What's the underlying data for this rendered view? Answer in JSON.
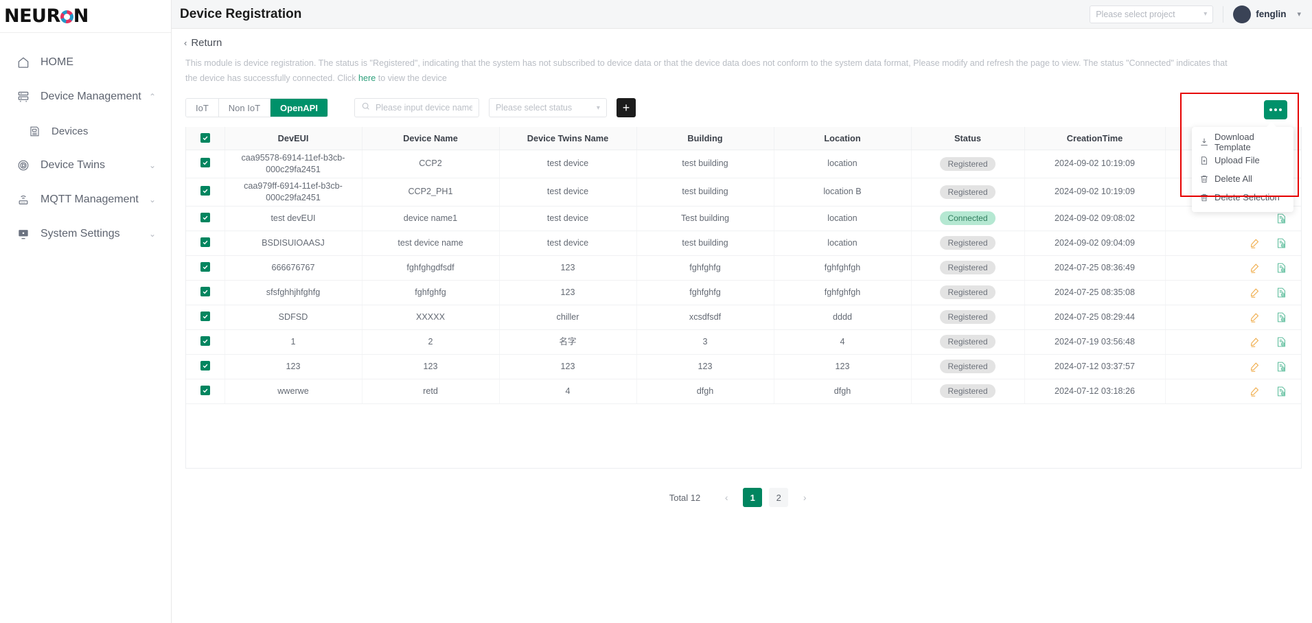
{
  "brand": {
    "name_left": "NEUR",
    "name_right": "N",
    "dot_icon": "neuron-dot-icon"
  },
  "sidebar": {
    "items": [
      {
        "label": "HOME",
        "icon": "home-icon",
        "chevron": "",
        "sub": false
      },
      {
        "label": "Device Management",
        "icon": "server-icon",
        "chevron": "⌃",
        "sub": false
      },
      {
        "label": "Devices",
        "icon": "device-icon",
        "chevron": "",
        "sub": true
      },
      {
        "label": "Device Twins",
        "icon": "twins-icon",
        "chevron": "⌄",
        "sub": false
      },
      {
        "label": "MQTT Management",
        "icon": "mqtt-icon",
        "chevron": "⌄",
        "sub": false
      },
      {
        "label": "System Settings",
        "icon": "monitor-icon",
        "chevron": "⌄",
        "sub": false
      }
    ]
  },
  "header": {
    "title": "Device Registration",
    "project_placeholder": "Please select project",
    "user_name": "fenglin"
  },
  "page": {
    "return_label": "Return",
    "description_part1": "This module is device registration. The status is \"Registered\", indicating that the system has not subscribed to device data or that the device data does not conform to the system data format, Please modify and refresh the page to view. The status \"Connected\" indicates that the device has successfully connected. Click ",
    "description_link": "here",
    "description_part2": " to view the device"
  },
  "toolbar": {
    "tabs": [
      {
        "label": "IoT",
        "active": false
      },
      {
        "label": "Non IoT",
        "active": false
      },
      {
        "label": "OpenAPI",
        "active": true
      }
    ],
    "search_placeholder": "Please input device name",
    "search_value": "",
    "status_placeholder": "Please select status",
    "add_label": "+",
    "more_label": "•••"
  },
  "dropdown": {
    "items": [
      {
        "label": "Download Template",
        "icon": "download-icon"
      },
      {
        "label": "Upload File",
        "icon": "upload-file-icon"
      },
      {
        "label": "Delete All",
        "icon": "trash-icon"
      },
      {
        "label": "Delete Selection",
        "icon": "trash-icon"
      }
    ]
  },
  "table": {
    "columns": [
      "DevEUI",
      "Device Name",
      "Device Twins Name",
      "Building",
      "Location",
      "Status",
      "CreationTime",
      ""
    ],
    "rows": [
      {
        "checked": true,
        "deveui": "caa95578-6914-11ef-b3cb-000c29fa2451",
        "device_name": "CCP2",
        "twins_name": "test device",
        "building": "test building",
        "location": "location",
        "status": "Registered",
        "status_kind": "registered",
        "creation_time": "2024-09-02 10:19:09",
        "has_edit": true
      },
      {
        "checked": true,
        "deveui": "caa979ff-6914-11ef-b3cb-000c29fa2451",
        "device_name": "CCP2_PH1",
        "twins_name": "test device",
        "building": "test building",
        "location": "location B",
        "status": "Registered",
        "status_kind": "registered",
        "creation_time": "2024-09-02 10:19:09",
        "has_edit": true
      },
      {
        "checked": true,
        "deveui": "test devEUI",
        "device_name": "device name1",
        "twins_name": "test device",
        "building": "Test building",
        "location": "location",
        "status": "Connected",
        "status_kind": "connected",
        "creation_time": "2024-09-02 09:08:02",
        "has_edit": false
      },
      {
        "checked": true,
        "deveui": "BSDISUIOAASJ",
        "device_name": "test device name",
        "twins_name": "test device",
        "building": "test building",
        "location": "location",
        "status": "Registered",
        "status_kind": "registered",
        "creation_time": "2024-09-02 09:04:09",
        "has_edit": true
      },
      {
        "checked": true,
        "deveui": "666676767",
        "device_name": "fghfghgdfsdf",
        "twins_name": "123",
        "building": "fghfghfg",
        "location": "fghfghfgh",
        "status": "Registered",
        "status_kind": "registered",
        "creation_time": "2024-07-25 08:36:49",
        "has_edit": true
      },
      {
        "checked": true,
        "deveui": "sfsfghhjhfghfg",
        "device_name": "fghfghfg",
        "twins_name": "123",
        "building": "fghfghfg",
        "location": "fghfghfgh",
        "status": "Registered",
        "status_kind": "registered",
        "creation_time": "2024-07-25 08:35:08",
        "has_edit": true
      },
      {
        "checked": true,
        "deveui": "SDFSD",
        "device_name": "XXXXX",
        "twins_name": "chiller",
        "building": "xcsdfsdf",
        "location": "dddd",
        "status": "Registered",
        "status_kind": "registered",
        "creation_time": "2024-07-25 08:29:44",
        "has_edit": true
      },
      {
        "checked": true,
        "deveui": "1",
        "device_name": "2",
        "twins_name": "名字",
        "building": "3",
        "location": "4",
        "status": "Registered",
        "status_kind": "registered",
        "creation_time": "2024-07-19 03:56:48",
        "has_edit": true
      },
      {
        "checked": true,
        "deveui": "123",
        "device_name": "123",
        "twins_name": "123",
        "building": "123",
        "location": "123",
        "status": "Registered",
        "status_kind": "registered",
        "creation_time": "2024-07-12 03:37:57",
        "has_edit": true
      },
      {
        "checked": true,
        "deveui": "wwerwe",
        "device_name": "retd",
        "twins_name": "4",
        "building": "dfgh",
        "location": "dfgh",
        "status": "Registered",
        "status_kind": "registered",
        "creation_time": "2024-07-12 03:18:26",
        "has_edit": true
      }
    ]
  },
  "pagination": {
    "total_label": "Total 12",
    "prev": "‹",
    "pages": [
      "1",
      "2"
    ],
    "current": "1",
    "next": "›"
  },
  "colors": {
    "accent": "#00916a",
    "accent_dark": "#00855f",
    "highlight": "#e60000",
    "badge_registered_bg": "#e3e3e3",
    "badge_connected_bg": "#b5e8d2",
    "edit_icon": "#f0ae4e",
    "view_icon": "#5dbd9c"
  }
}
